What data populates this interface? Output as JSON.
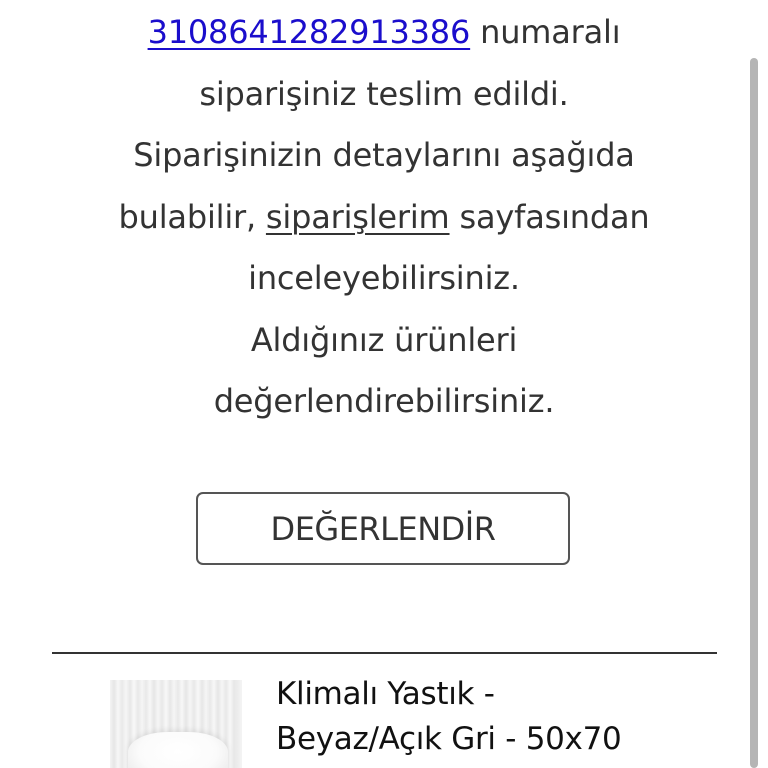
{
  "message": {
    "order_number": "3108641282913386",
    "line1_rest": " numaralı",
    "line2": "siparişiniz teslim edildi.",
    "line3": "Siparişinizin detaylarını aşağıda",
    "line4_prefix": "bulabilir, ",
    "orders_link": "siparişlerim",
    "line4_suffix": " sayfasından",
    "line5": "inceleyebilirsiniz.",
    "line6": "Aldığınız ürünleri",
    "line7": "değerlendirebilirsiniz."
  },
  "rate_button": {
    "label": "DEĞERLENDİR"
  },
  "product": {
    "title_line1": "Klimalı Yastık -",
    "title_line2": "Beyaz/Açık Gri - 50x70"
  },
  "colors": {
    "link": "#1a0dcc",
    "text": "#333333",
    "border": "#555555"
  }
}
